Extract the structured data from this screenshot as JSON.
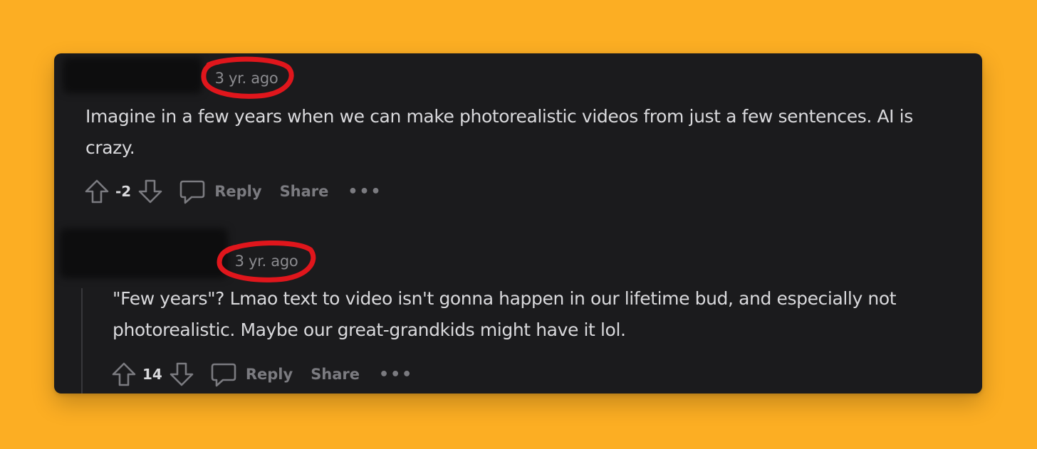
{
  "comments": [
    {
      "timestamp": "3 yr. ago",
      "text": "Imagine in a few years when we can make photorealistic videos from just a few sentences. AI is crazy.",
      "score": "-2",
      "reply_label": "Reply",
      "share_label": "Share",
      "more_label": "•••"
    },
    {
      "timestamp": "3 yr. ago",
      "text": "\"Few years\"? Lmao text to video isn't gonna happen in our lifetime bud, and especially not photorealistic. Maybe our great-grandkids might have it lol.",
      "score": "14",
      "reply_label": "Reply",
      "share_label": "Share",
      "more_label": "•••"
    }
  ],
  "colors": {
    "background": "#FCAE23",
    "card": "#1b1b1d",
    "annotation": "#e0161c",
    "text": "#d9d9dc",
    "muted": "#7b7b80"
  },
  "icons": [
    "upvote-icon",
    "downvote-icon",
    "comment-icon"
  ]
}
